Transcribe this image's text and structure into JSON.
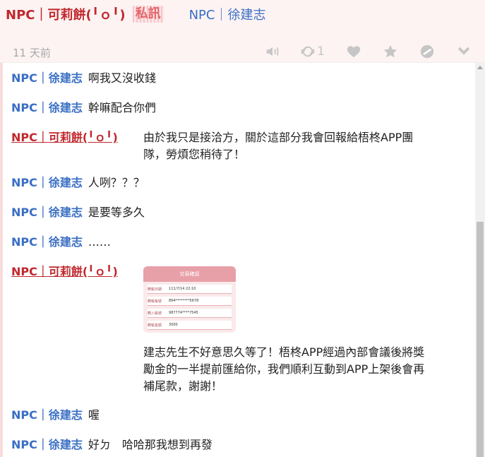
{
  "post": {
    "sender": "NPC｜可莉餅(╹ｏ╹)",
    "pm_tag": "私訊",
    "receiver": "NPC｜徐建志",
    "time": "11 天前",
    "repost_count": "1",
    "icons": [
      "volume-icon",
      "repost-icon",
      "heart-icon",
      "star-icon",
      "hide-icon",
      "chevron-down-icon"
    ]
  },
  "messages": [
    {
      "name": "NPC｜徐建志",
      "text": "啊我又沒收錢"
    },
    {
      "name": "NPC｜徐建志",
      "text": "幹嘛配合你們"
    },
    {
      "name": "NPC｜可莉餅(╹ｏ╹)",
      "line1": "由於我只是接洽方，關於這部分我會回報給梧柊APP團",
      "line2": "隊，勞煩您稍待了！"
    },
    {
      "name": "NPC｜徐建志",
      "text": "人咧？？？"
    },
    {
      "name": "NPC｜徐建志",
      "text": "是要等多久"
    },
    {
      "name": "NPC｜徐建志",
      "text": "……"
    },
    {
      "name": "NPC｜可莉餅(╹ｏ╹)",
      "receipt": {
        "title": "交易確認",
        "rows": [
          {
            "label": "轉帳日期",
            "value": "111/7/14 22:10"
          },
          {
            "label": "轉帳帳號",
            "value": "864********5678"
          },
          {
            "label": "轉入帳號",
            "value": "987774****7545"
          },
          {
            "label": "轉帳金額",
            "value": "3000"
          }
        ]
      },
      "line1": "建志先生不好意思久等了！梧柊APP經過內部會議後將獎",
      "line2": "勵金的一半提前匯給你，我們順利互動到APP上架後會再",
      "line3": "補尾款，謝謝！"
    },
    {
      "name": "NPC｜徐建志",
      "text": "喔"
    },
    {
      "name": "NPC｜徐建志",
      "text": "好ㄉ　哈哈那我想到再發"
    }
  ],
  "colors": {
    "sender": "#c0282d",
    "npc": "#3a6fc4",
    "header_bg": "#fdf3f3"
  }
}
